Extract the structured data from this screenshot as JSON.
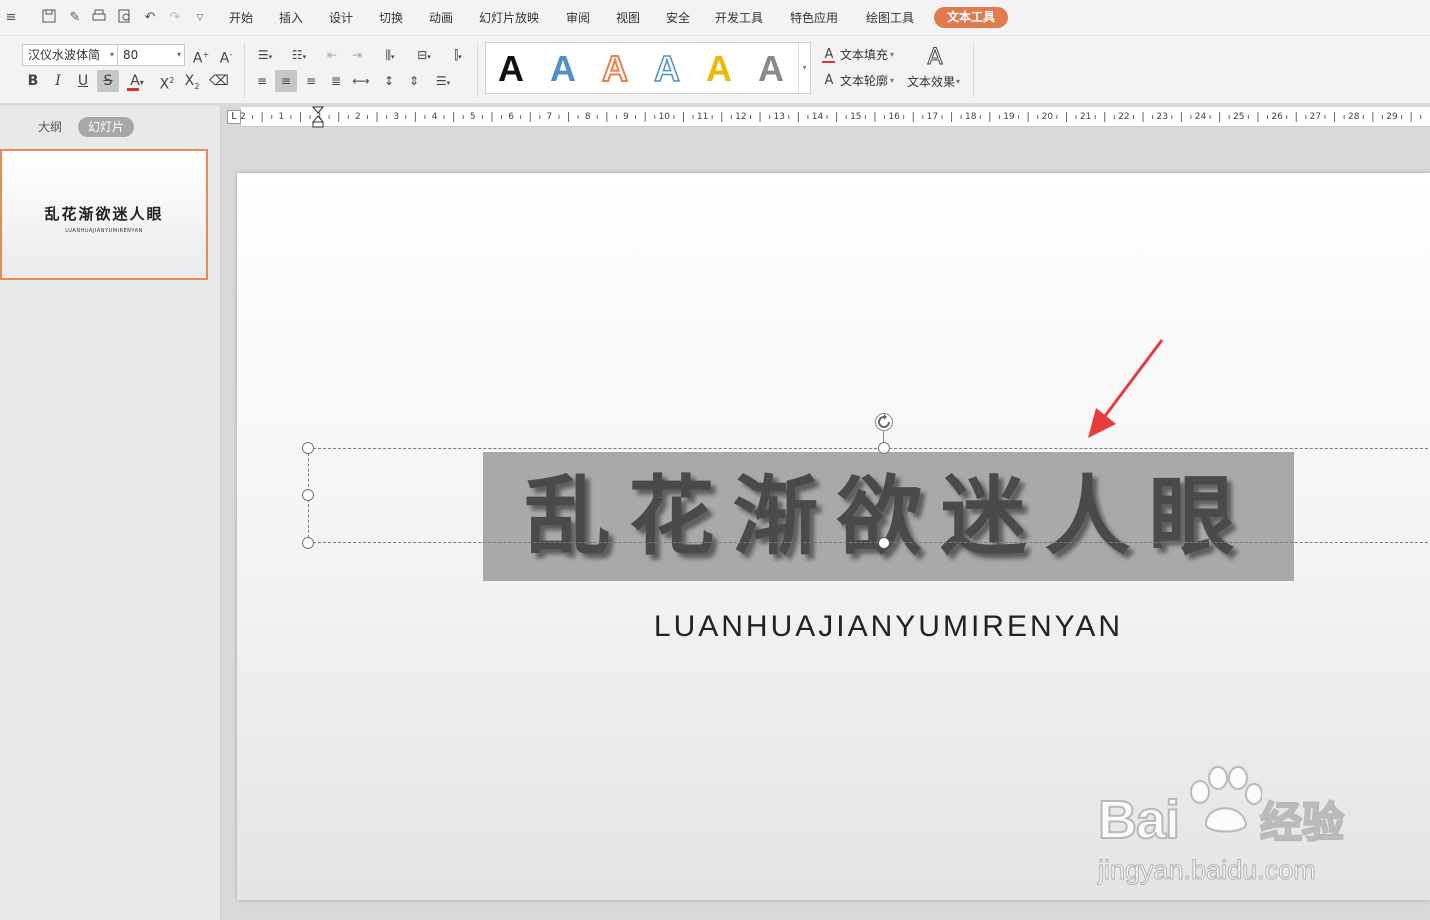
{
  "menubar": {
    "tabs": [
      "开始",
      "插入",
      "设计",
      "切换",
      "动画",
      "幻灯片放映",
      "审阅",
      "视图",
      "安全",
      "开发工具",
      "特色应用",
      "绘图工具"
    ],
    "active_context_tab": "文本工具",
    "accent": "#e07b4f"
  },
  "ribbon": {
    "font_name": "汉仪水波体简",
    "font_size": "80",
    "text_fill_label": "文本填充",
    "text_outline_label": "文本轮廓",
    "text_effect_label": "文本效果",
    "style_glyph": "A",
    "style_colors": [
      "#111111",
      "#4f8fd0",
      "#e8824a",
      "#ffffff",
      "#f2b705",
      "#8a8a8a"
    ],
    "font_color": "#e03030"
  },
  "left_panel": {
    "tab_outline": "大纲",
    "tab_slides": "幻灯片",
    "thumb_title": "乱花渐欲迷人眼",
    "thumb_subtitle": "LUANHUAJIANYUMIRENYAN"
  },
  "ruler": {
    "labels": [
      "2",
      "1",
      "1",
      "2",
      "3",
      "4",
      "5",
      "6",
      "7",
      "8",
      "9",
      "10",
      "11",
      "12",
      "13",
      "14",
      "15",
      "16",
      "17",
      "18",
      "19",
      "20",
      "21",
      "22",
      "23",
      "24",
      "25",
      "26",
      "27",
      "28",
      "29"
    ]
  },
  "slide": {
    "title": "乱花渐欲迷人眼",
    "subtitle": "LUANHUAJIANYUMIRENYAN"
  },
  "watermark": {
    "brand": "Bai",
    "brand_cn": "经验",
    "url": "jingyan.baidu.com"
  }
}
